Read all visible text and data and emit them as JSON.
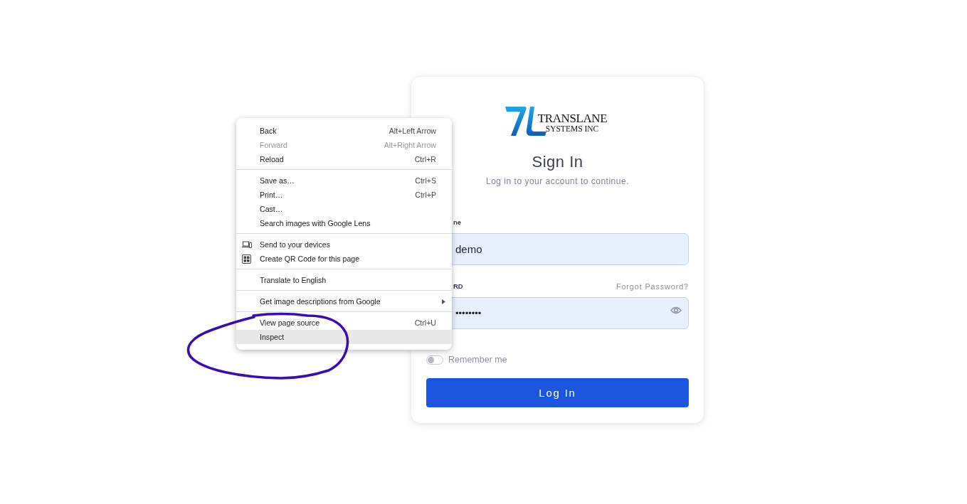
{
  "login_card": {
    "logo": {
      "line_1": "TRANSLANE",
      "line_2": "SYSTEMS INC"
    },
    "title": "Sign In",
    "subtitle": "Log in to your account to continue.",
    "username": {
      "label": "ne",
      "value": "demo"
    },
    "password": {
      "label": "RD",
      "value": "••••••••",
      "forgot_link": "Forgot Password?"
    },
    "remember_me": {
      "label": "Remember me",
      "on": false
    },
    "submit_button": "Log In"
  },
  "context_menu": {
    "groups": [
      {
        "items": [
          {
            "kind": "plain",
            "label": "Back",
            "shortcut": "Alt+Left Arrow",
            "disabled": false,
            "highlighted": false
          },
          {
            "kind": "plain",
            "label": "Forward",
            "shortcut": "Alt+Right Arrow",
            "disabled": true,
            "highlighted": false
          },
          {
            "kind": "plain",
            "label": "Reload",
            "shortcut": "Ctrl+R",
            "disabled": false,
            "highlighted": false
          }
        ]
      },
      {
        "items": [
          {
            "kind": "plain",
            "label": "Save as…",
            "shortcut": "Ctrl+S",
            "disabled": false,
            "highlighted": false
          },
          {
            "kind": "plain",
            "label": "Print…",
            "shortcut": "Ctrl+P",
            "disabled": false,
            "highlighted": false
          },
          {
            "kind": "plain",
            "label": "Cast…",
            "disabled": false,
            "highlighted": false
          },
          {
            "kind": "plain",
            "label": "Search images with Google Lens",
            "disabled": false,
            "highlighted": false
          }
        ]
      },
      {
        "items": [
          {
            "kind": "devices",
            "label": "Send to your devices",
            "disabled": false,
            "highlighted": false
          },
          {
            "kind": "qr_code",
            "label": "Create QR Code for this page",
            "disabled": false,
            "highlighted": false
          }
        ]
      },
      {
        "items": [
          {
            "kind": "plain",
            "label": "Translate to English",
            "disabled": false,
            "highlighted": false
          }
        ]
      },
      {
        "items": [
          {
            "kind": "submenu",
            "label": "Get image descriptions from Google",
            "disabled": false,
            "highlighted": false
          }
        ]
      },
      {
        "items": [
          {
            "kind": "plain",
            "label": "View page source",
            "shortcut": "Ctrl+U",
            "disabled": false,
            "highlighted": false
          },
          {
            "kind": "plain",
            "label": "Inspect",
            "disabled": false,
            "highlighted": true
          }
        ]
      }
    ]
  },
  "annotations": [
    {
      "kind": "freehand_circle"
    }
  ]
}
